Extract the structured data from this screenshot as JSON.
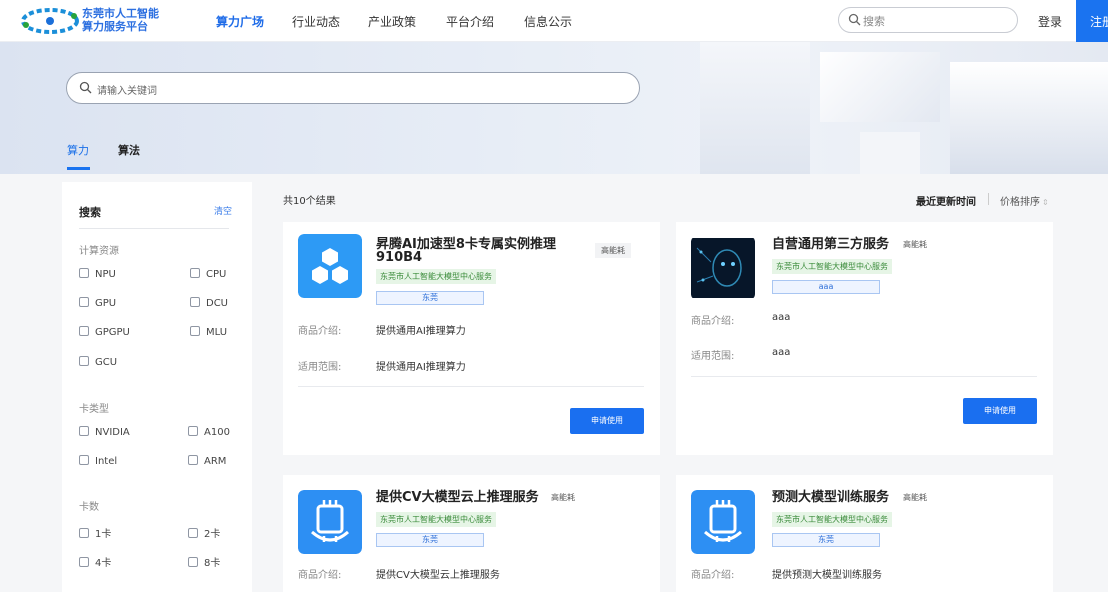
{
  "header": {
    "logo_line1": "东莞市人工智能",
    "logo_line2": "算力服务平台",
    "nav": [
      {
        "label": "算力广场",
        "active": true
      },
      {
        "label": "行业动态"
      },
      {
        "label": "产业政策"
      },
      {
        "label": "平台介绍"
      },
      {
        "label": "信息公示"
      }
    ],
    "search_placeholder": "搜索",
    "login_label": "登录",
    "register_label": "注册"
  },
  "banner": {
    "search_placeholder": "请输入关键词",
    "tabs": [
      {
        "label": "算力",
        "active": true
      },
      {
        "label": "算法"
      }
    ]
  },
  "sidebar": {
    "title": "搜索",
    "clear_label": "清空",
    "groups": [
      {
        "title": "计算资源",
        "options": [
          "NPU",
          "CPU",
          "GPU",
          "DCU",
          "GPGPU",
          "MLU",
          "GCU"
        ]
      },
      {
        "title": "卡类型",
        "options": [
          "NVIDIA",
          "A100",
          "Intel",
          "ARM"
        ]
      },
      {
        "title": "卡数",
        "options": [
          "1卡",
          "2卡",
          "4卡",
          "8卡"
        ]
      }
    ]
  },
  "results": {
    "count_text": "共10个结果",
    "sort_latest": "最近更新时间",
    "sort_price": "价格排序",
    "sort_price_icon": "sort-arrows-icon"
  },
  "cards": [
    {
      "name_line1": "昇腾AI加速型8卡专属实例推理",
      "name_line2": "910B4",
      "badge": "高能耗",
      "provider": "东莞市人工智能大模型中心服务",
      "region": "东莞",
      "intro_label": "商品介绍:",
      "intro": "提供通用AI推理算力",
      "scope_label": "适用范围:",
      "scope": "提供通用AI推理算力",
      "apply_label": "申请使用",
      "icon": "hexagon-cluster-icon"
    },
    {
      "name_line1": "自营通用第三方服务",
      "badge": "高能耗",
      "provider": "东莞市人工智能大模型中心服务",
      "region": "aaa",
      "intro_label": "商品介绍:",
      "intro": "aaa",
      "scope_label": "适用范围:",
      "scope": "aaa",
      "apply_label": "申请使用",
      "icon": "ai-face-image-icon"
    },
    {
      "name_line1": "提供CV大模型云上推理服务",
      "badge": "高能耗",
      "provider": "东莞市人工智能大模型中心服务",
      "region": "东莞",
      "intro_label": "商品介绍:",
      "intro": "提供CV大模型云上推理服务",
      "icon": "ai-chip-icon"
    },
    {
      "name_line1": "预测大模型训练服务",
      "badge": "高能耗",
      "provider": "东莞市人工智能大模型中心服务",
      "region": "东莞",
      "intro_label": "商品介绍:",
      "intro": "提供预测大模型训练服务",
      "icon": "ai-chip-icon"
    }
  ],
  "colors": {
    "primary": "#1a6ff0",
    "brand_text": "#2c6fe0",
    "provider_green": "#3a8b3a"
  }
}
